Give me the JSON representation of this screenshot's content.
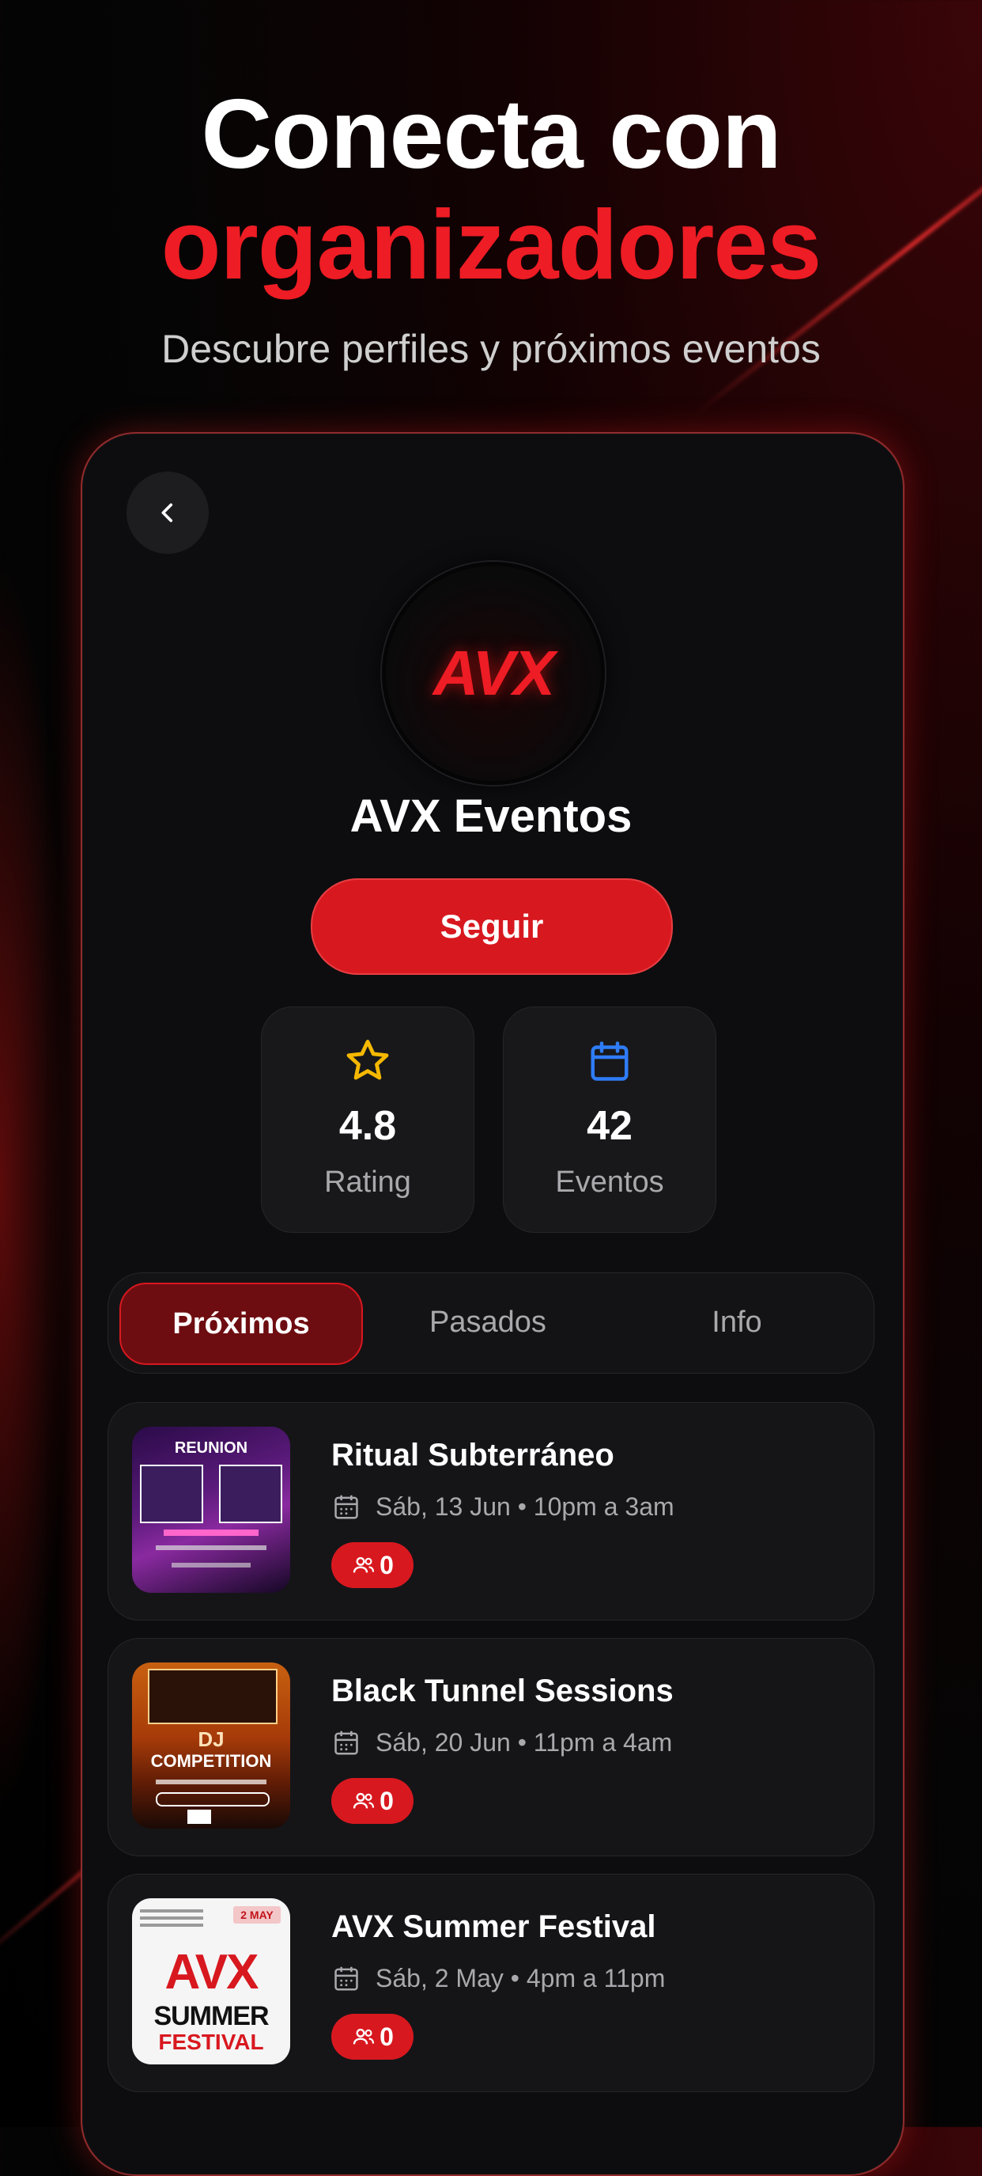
{
  "hero": {
    "title_line1": "Conecta con",
    "title_line2": "organizadores",
    "subtitle": "Descubre perfiles y próximos eventos"
  },
  "colors": {
    "accent": "#ee1c24",
    "button": "#d8181f",
    "star": "#f5b800",
    "calendar": "#2f7cf6"
  },
  "profile": {
    "avatar_text": "AVX",
    "name": "AVX Eventos",
    "follow_label": "Seguir"
  },
  "stats": [
    {
      "icon": "star-icon",
      "value": "4.8",
      "label": "Rating"
    },
    {
      "icon": "calendar-icon",
      "value": "42",
      "label": "Eventos"
    }
  ],
  "tabs": [
    {
      "label": "Próximos",
      "active": true
    },
    {
      "label": "Pasados",
      "active": false
    },
    {
      "label": "Info",
      "active": false
    }
  ],
  "events": [
    {
      "title": "Ritual Subterráneo",
      "date": "Sáb, 13 Jun • 10pm a 3am",
      "attendees": "0",
      "thumb_text": "REUNION"
    },
    {
      "title": "Black Tunnel Sessions",
      "date": "Sáb, 20 Jun • 11pm a 4am",
      "attendees": "0",
      "thumb_text_1": "DJ",
      "thumb_text_2": "COMPETITION"
    },
    {
      "title": "AVX Summer Festival",
      "date": "Sáb, 2 May • 4pm a 11pm",
      "attendees": "0",
      "thumb_tag": "2 MAY",
      "thumb_text_1": "AVX",
      "thumb_text_2": "SUMMER",
      "thumb_text_3": "FESTIVAL"
    }
  ]
}
